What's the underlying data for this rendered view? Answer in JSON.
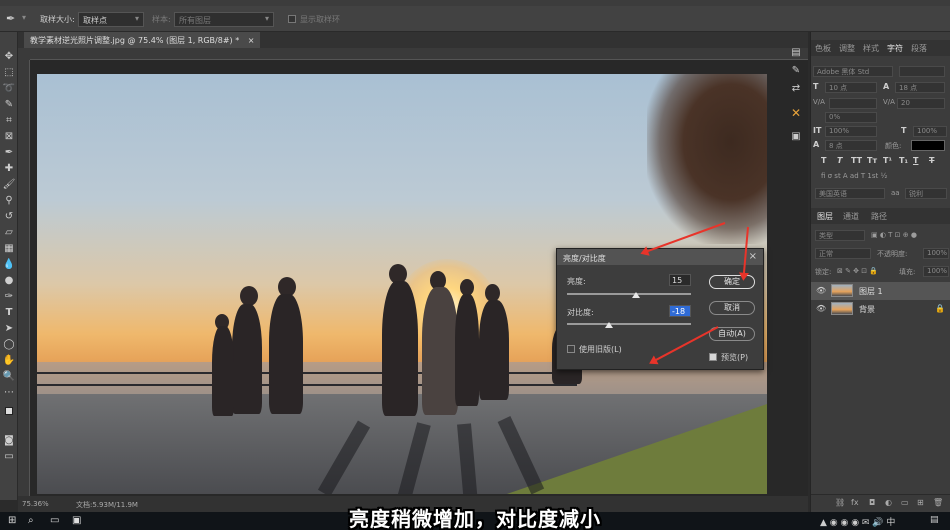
{
  "options_bar": {
    "sample_size_label": "取样大小:",
    "sample_size_value": "取样点",
    "sample_label": "样本:",
    "sample_value": "所有图层",
    "show_ring_label": "显示取样环"
  },
  "document": {
    "tab_title": "教学素材逆光照片调整.jpg @ 75.4% (图层 1, RGB/8#) *",
    "tab_close": "×"
  },
  "status_bar": {
    "zoom": "75.36%",
    "doc_info": "文档:5.93M/11.9M"
  },
  "dialog": {
    "title": "亮度/对比度",
    "close": "×",
    "brightness_label": "亮度:",
    "brightness_value": "15",
    "contrast_label": "对比度:",
    "contrast_value": "-18",
    "legacy_label": "使用旧版(L)",
    "legacy_checked": false,
    "ok_label": "确定",
    "cancel_label": "取消",
    "auto_label": "自动(A)",
    "preview_label": "预览(P)",
    "preview_checked": true
  },
  "char_panel": {
    "tabs": [
      "色板",
      "调整",
      "样式",
      "字符",
      "段落"
    ],
    "active_tab": "字符",
    "font_family": "Adobe 黑体 Std",
    "font_size": "10 点",
    "leading": "18 点",
    "kerning": "V/A",
    "tracking": "20",
    "tsume": "0%",
    "vscale": "100%",
    "hscale": "100%",
    "baseline": "8 点",
    "color_label": "颜色:",
    "language": "美国英语",
    "aa_label": "a​a",
    "aa_value": "锐利"
  },
  "layers_panel": {
    "tabs": [
      "图层",
      "通道",
      "路径"
    ],
    "active_tab": "图层",
    "filter": "类型",
    "blend_mode": "正常",
    "opacity_label": "不透明度:",
    "opacity": "100%",
    "lock_label": "锁定:",
    "fill_label": "填充:",
    "fill": "100%",
    "layers": [
      {
        "name": "图层 1",
        "selected": true
      },
      {
        "name": "背景",
        "selected": false,
        "locked": true
      }
    ]
  },
  "subtitle": "亮度稍微增加，对比度减小",
  "colors": {
    "annotation_arrow": "#e8342a",
    "dialog_bg": "#3d3d3d",
    "panel_bg": "#3c3c3c",
    "selection_highlight": "#2f6bd6"
  }
}
